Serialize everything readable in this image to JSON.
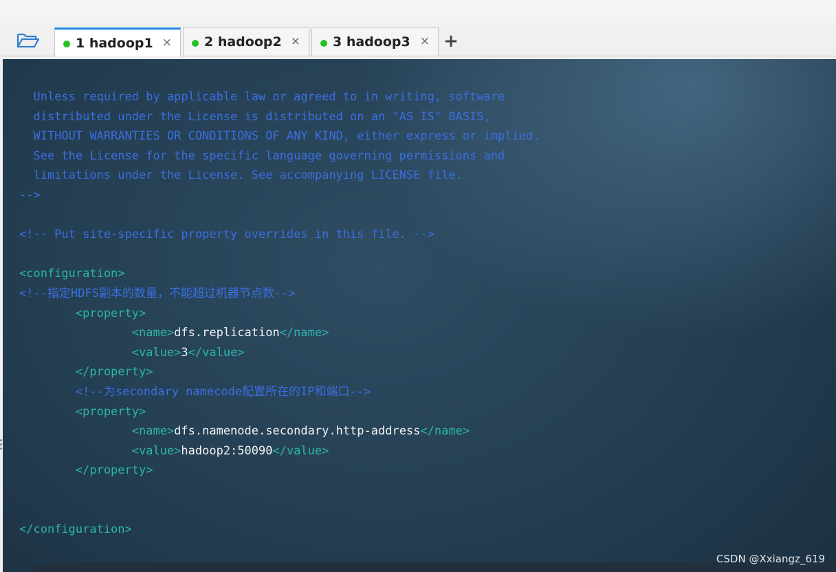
{
  "tabs": [
    {
      "label": "1 hadoop1",
      "active": true,
      "status_color": "#22c322"
    },
    {
      "label": "2 hadoop2",
      "active": false,
      "status_color": "#22c322"
    },
    {
      "label": "3 hadoop3",
      "active": false,
      "status_color": "#22c322"
    }
  ],
  "tab_close_glyph": "×",
  "add_tab_glyph": "+",
  "colors": {
    "comment": "#3a6fe0",
    "tag": "#2bb6a8",
    "value": "#f2f2f2",
    "active_tab_accent": "#1e88e5"
  },
  "terminal": {
    "lines": [
      [
        {
          "t": "  Unless required by applicable law or agreed to in writing, software",
          "k": "c"
        }
      ],
      [
        {
          "t": "  distributed under the License is distributed on an \"AS IS\" BASIS,",
          "k": "c"
        }
      ],
      [
        {
          "t": "  WITHOUT WARRANTIES OR CONDITIONS OF ANY KIND, either express or implied.",
          "k": "c"
        }
      ],
      [
        {
          "t": "  See the License for the specific language governing permissions and",
          "k": "c"
        }
      ],
      [
        {
          "t": "  limitations under the License. See accompanying LICENSE file.",
          "k": "c"
        }
      ],
      [
        {
          "t": "-->",
          "k": "c"
        }
      ],
      [],
      [
        {
          "t": "<!-- Put site-specific property overrides in this file. -->",
          "k": "c"
        }
      ],
      [],
      [
        {
          "t": "<configuration>",
          "k": "t"
        }
      ],
      [
        {
          "t": "<!--指定HDFS副本的数量，不能超过机器节点数-->",
          "k": "c"
        }
      ],
      [
        {
          "t": "        <property>",
          "k": "t"
        }
      ],
      [
        {
          "t": "                <name>",
          "k": "t"
        },
        {
          "t": "dfs.replication",
          "k": "v"
        },
        {
          "t": "</name>",
          "k": "t"
        }
      ],
      [
        {
          "t": "                <value>",
          "k": "t"
        },
        {
          "t": "3",
          "k": "v"
        },
        {
          "t": "</value>",
          "k": "t"
        }
      ],
      [
        {
          "t": "        </property>",
          "k": "t"
        }
      ],
      [
        {
          "t": "        <!--为secondary namecode配置所在的IP和端口-->",
          "k": "c"
        }
      ],
      [
        {
          "t": "        <property>",
          "k": "t"
        }
      ],
      [
        {
          "t": "                <name>",
          "k": "t"
        },
        {
          "t": "dfs.namenode.secondary.http-address",
          "k": "v"
        },
        {
          "t": "</name>",
          "k": "t"
        }
      ],
      [
        {
          "t": "                <value>",
          "k": "t"
        },
        {
          "t": "hadoop2:50090",
          "k": "v"
        },
        {
          "t": "</value>",
          "k": "t"
        }
      ],
      [
        {
          "t": "        </property>",
          "k": "t"
        }
      ],
      [],
      [],
      [
        {
          "t": "</configuration>",
          "k": "t"
        }
      ]
    ]
  },
  "watermark": "CSDN @Xxiangz_619"
}
